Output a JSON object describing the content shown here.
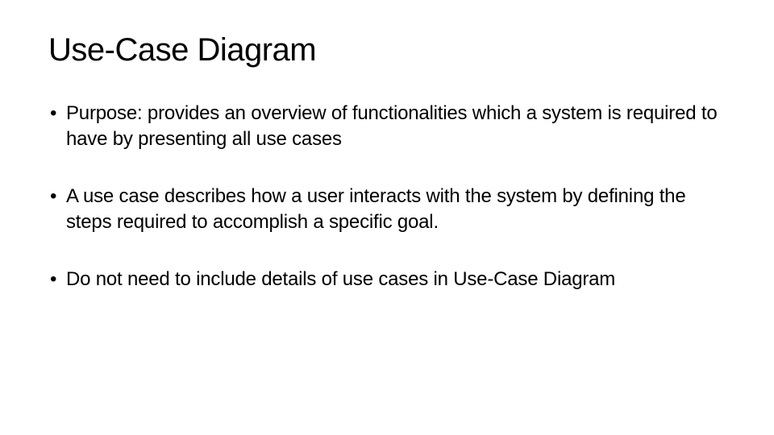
{
  "slide": {
    "title": "Use-Case Diagram",
    "bullets": [
      "Purpose: provides an overview of functionalities which a system is required to have by presenting all use cases",
      "A use case describes how a user interacts with the system by defining the steps required to accomplish a specific goal.",
      "Do not need to include details of use cases in Use-Case Diagram"
    ]
  }
}
